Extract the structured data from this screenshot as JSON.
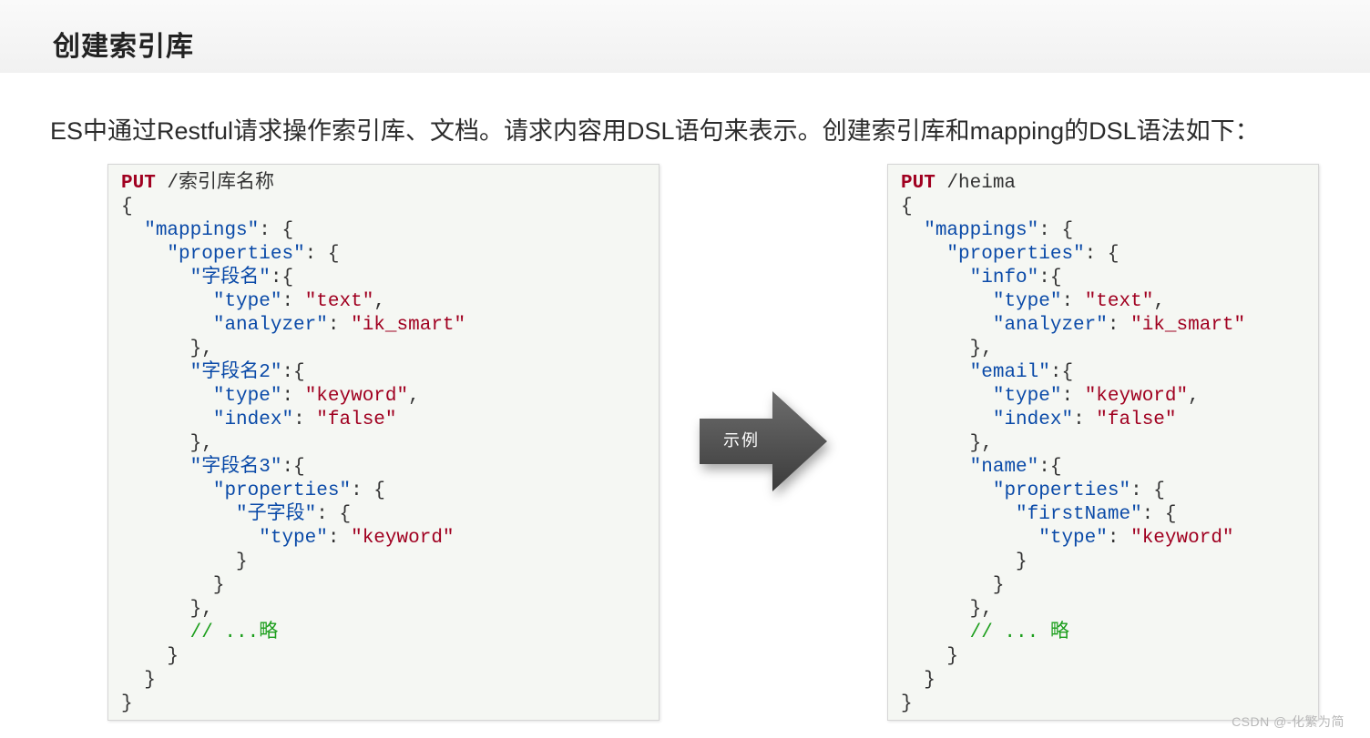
{
  "title": "创建索引库",
  "description": "ES中通过Restful请求操作索引库、文档。请求内容用DSL语句来表示。创建索引库和mapping的DSL语法如下：",
  "arrow_label": "示例",
  "left_code": {
    "method": "PUT",
    "path": "/索引库名称",
    "mappings_key": "mappings",
    "properties_key": "properties",
    "field1": {
      "name": "字段名",
      "type_key": "type",
      "type_val": "text",
      "analyzer_key": "analyzer",
      "analyzer_val": "ik_smart"
    },
    "field2": {
      "name": "字段名2",
      "type_key": "type",
      "type_val": "keyword",
      "index_key": "index",
      "index_val": "false"
    },
    "field3": {
      "name": "字段名3",
      "props_key": "properties",
      "sub_name": "子字段",
      "sub_type_key": "type",
      "sub_type_val": "keyword"
    },
    "comment": "// ...略"
  },
  "right_code": {
    "method": "PUT",
    "path": "/heima",
    "mappings_key": "mappings",
    "properties_key": "properties",
    "field1": {
      "name": "info",
      "type_key": "type",
      "type_val": "text",
      "analyzer_key": "analyzer",
      "analyzer_val": "ik_smart"
    },
    "field2": {
      "name": "email",
      "type_key": "type",
      "type_val": "keyword",
      "index_key": "index",
      "index_val": "false"
    },
    "field3": {
      "name": "name",
      "props_key": "properties",
      "sub_name": "firstName",
      "sub_type_key": "type",
      "sub_type_val": "keyword"
    },
    "comment": "// ... 略"
  },
  "watermark": "CSDN @-化繁为简"
}
